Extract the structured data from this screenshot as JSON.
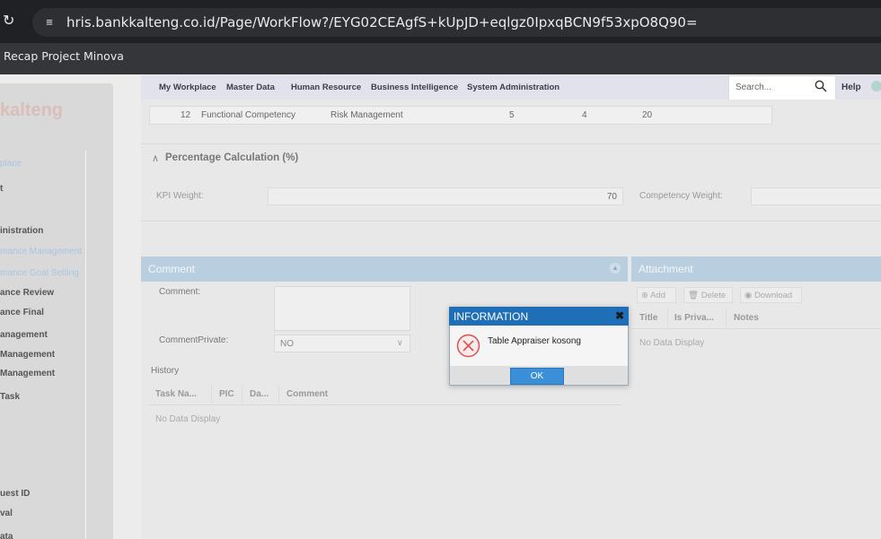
{
  "browser": {
    "url": "hris.bankkalteng.co.id/Page/WorkFlow?/EYG02CEAgfS+kUpJD+eqlgz0IpxqBCN9f53xpO8Q90=",
    "bookmark": "Recap Project Minova"
  },
  "sidebar": {
    "logo": "kalteng",
    "items": [
      {
        "label": "place",
        "faded": true
      },
      {
        "label": "t",
        "faded": false
      },
      {
        "label": "inistration",
        "faded": false
      },
      {
        "label": "mance Management",
        "faded": true
      },
      {
        "label": "mance Goal Setting",
        "faded": true
      },
      {
        "label": "ance Review",
        "faded": false
      },
      {
        "label": "ance Final",
        "faded": false
      },
      {
        "label": "anagement",
        "faded": false
      },
      {
        "label": "Management",
        "faded": false
      },
      {
        "label": "Management",
        "faded": false
      },
      {
        "label": "Task",
        "faded": false
      },
      {
        "label": "uest ID",
        "faded": false
      },
      {
        "label": "val",
        "faded": false
      },
      {
        "label": "ata",
        "faded": false
      }
    ]
  },
  "topnav": {
    "items": [
      "My Workplace",
      "Master Data",
      "Human Resource",
      "Business Intelligence",
      "System Administration"
    ],
    "search_placeholder": "Search...",
    "help": "Help"
  },
  "competency_row": {
    "no": "12",
    "type": "Functional Competency",
    "name": "Risk Management",
    "c1": "5",
    "c2": "4",
    "c3": "20"
  },
  "percentage": {
    "title": "Percentage Calculation (%)",
    "kpi_label": "KPI Weight:",
    "kpi_value": "70",
    "competency_label": "Competency Weight:"
  },
  "comment": {
    "title": "Comment",
    "comment_label": "Comment:",
    "private_label": "CommentPrivate:",
    "private_value": "NO",
    "history_label": "History",
    "columns": [
      "Task Na...",
      "PIC",
      "Da...",
      "Comment"
    ],
    "empty": "No Data Display"
  },
  "attachment": {
    "title": "Attachment",
    "buttons": [
      "Add",
      "Delete",
      "Download"
    ],
    "columns": [
      "Title",
      "Is Priva...",
      "Notes"
    ],
    "empty": "No Data Display"
  },
  "dialog": {
    "title": "INFORMATION",
    "message": "Table Appraiser kosong",
    "ok": "OK"
  }
}
